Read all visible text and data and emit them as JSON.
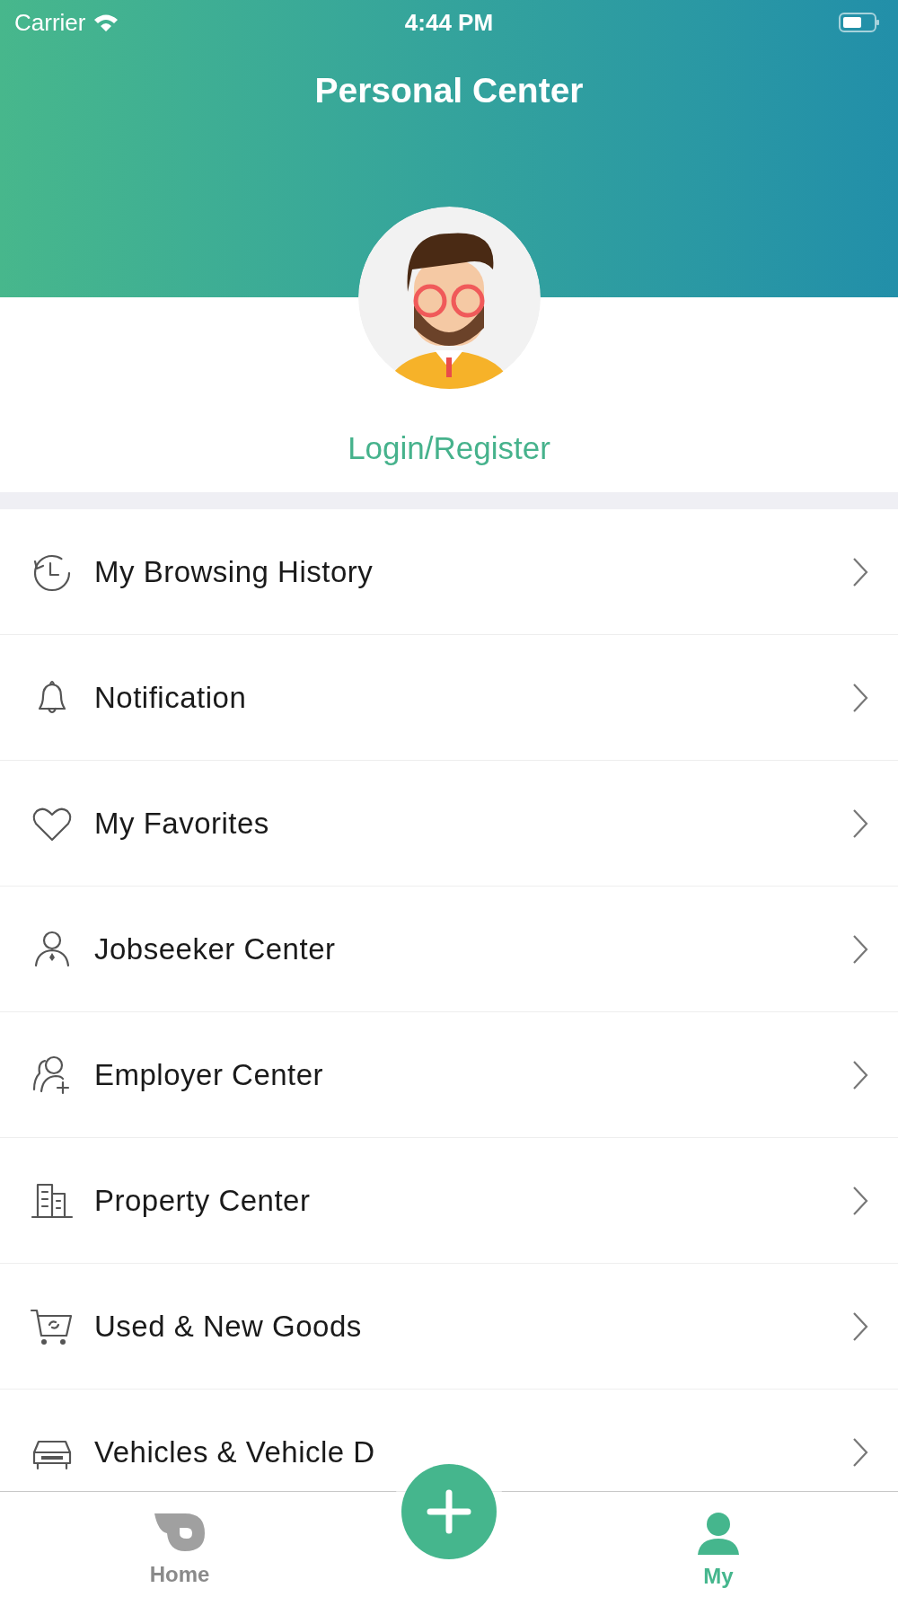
{
  "status_bar": {
    "carrier": "Carrier",
    "time": "4:44 PM"
  },
  "header": {
    "title": "Personal Center"
  },
  "profile": {
    "login_link": "Login/Register"
  },
  "menu": [
    {
      "label": "My Browsing History",
      "kind": "history"
    },
    {
      "label": "Notification",
      "kind": "bell"
    },
    {
      "label": "My Favorites",
      "kind": "heart"
    },
    {
      "label": "Jobseeker Center",
      "kind": "jobseeker"
    },
    {
      "label": "Employer Center",
      "kind": "employer"
    },
    {
      "label": "Property Center",
      "kind": "building"
    },
    {
      "label": "Used & New Goods",
      "kind": "cart"
    },
    {
      "label": "Vehicles & Vehicle D",
      "kind": "car"
    }
  ],
  "tab_bar": {
    "tabs": [
      {
        "label": "Home",
        "kind": "home",
        "selected": false
      },
      {
        "label": "My",
        "kind": "person",
        "selected": true
      }
    ]
  }
}
